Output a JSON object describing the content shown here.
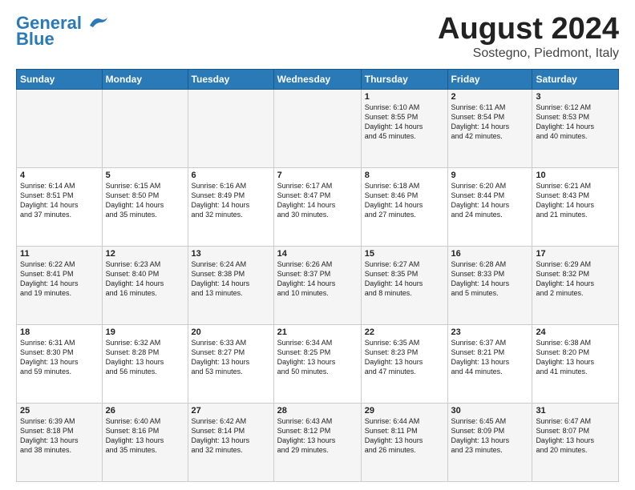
{
  "header": {
    "logo_line1": "General",
    "logo_line2": "Blue",
    "month": "August 2024",
    "location": "Sostegno, Piedmont, Italy"
  },
  "weekdays": [
    "Sunday",
    "Monday",
    "Tuesday",
    "Wednesday",
    "Thursday",
    "Friday",
    "Saturday"
  ],
  "weeks": [
    [
      {
        "num": "",
        "info": ""
      },
      {
        "num": "",
        "info": ""
      },
      {
        "num": "",
        "info": ""
      },
      {
        "num": "",
        "info": ""
      },
      {
        "num": "1",
        "info": "Sunrise: 6:10 AM\nSunset: 8:55 PM\nDaylight: 14 hours\nand 45 minutes."
      },
      {
        "num": "2",
        "info": "Sunrise: 6:11 AM\nSunset: 8:54 PM\nDaylight: 14 hours\nand 42 minutes."
      },
      {
        "num": "3",
        "info": "Sunrise: 6:12 AM\nSunset: 8:53 PM\nDaylight: 14 hours\nand 40 minutes."
      }
    ],
    [
      {
        "num": "4",
        "info": "Sunrise: 6:14 AM\nSunset: 8:51 PM\nDaylight: 14 hours\nand 37 minutes."
      },
      {
        "num": "5",
        "info": "Sunrise: 6:15 AM\nSunset: 8:50 PM\nDaylight: 14 hours\nand 35 minutes."
      },
      {
        "num": "6",
        "info": "Sunrise: 6:16 AM\nSunset: 8:49 PM\nDaylight: 14 hours\nand 32 minutes."
      },
      {
        "num": "7",
        "info": "Sunrise: 6:17 AM\nSunset: 8:47 PM\nDaylight: 14 hours\nand 30 minutes."
      },
      {
        "num": "8",
        "info": "Sunrise: 6:18 AM\nSunset: 8:46 PM\nDaylight: 14 hours\nand 27 minutes."
      },
      {
        "num": "9",
        "info": "Sunrise: 6:20 AM\nSunset: 8:44 PM\nDaylight: 14 hours\nand 24 minutes."
      },
      {
        "num": "10",
        "info": "Sunrise: 6:21 AM\nSunset: 8:43 PM\nDaylight: 14 hours\nand 21 minutes."
      }
    ],
    [
      {
        "num": "11",
        "info": "Sunrise: 6:22 AM\nSunset: 8:41 PM\nDaylight: 14 hours\nand 19 minutes."
      },
      {
        "num": "12",
        "info": "Sunrise: 6:23 AM\nSunset: 8:40 PM\nDaylight: 14 hours\nand 16 minutes."
      },
      {
        "num": "13",
        "info": "Sunrise: 6:24 AM\nSunset: 8:38 PM\nDaylight: 14 hours\nand 13 minutes."
      },
      {
        "num": "14",
        "info": "Sunrise: 6:26 AM\nSunset: 8:37 PM\nDaylight: 14 hours\nand 10 minutes."
      },
      {
        "num": "15",
        "info": "Sunrise: 6:27 AM\nSunset: 8:35 PM\nDaylight: 14 hours\nand 8 minutes."
      },
      {
        "num": "16",
        "info": "Sunrise: 6:28 AM\nSunset: 8:33 PM\nDaylight: 14 hours\nand 5 minutes."
      },
      {
        "num": "17",
        "info": "Sunrise: 6:29 AM\nSunset: 8:32 PM\nDaylight: 14 hours\nand 2 minutes."
      }
    ],
    [
      {
        "num": "18",
        "info": "Sunrise: 6:31 AM\nSunset: 8:30 PM\nDaylight: 13 hours\nand 59 minutes."
      },
      {
        "num": "19",
        "info": "Sunrise: 6:32 AM\nSunset: 8:28 PM\nDaylight: 13 hours\nand 56 minutes."
      },
      {
        "num": "20",
        "info": "Sunrise: 6:33 AM\nSunset: 8:27 PM\nDaylight: 13 hours\nand 53 minutes."
      },
      {
        "num": "21",
        "info": "Sunrise: 6:34 AM\nSunset: 8:25 PM\nDaylight: 13 hours\nand 50 minutes."
      },
      {
        "num": "22",
        "info": "Sunrise: 6:35 AM\nSunset: 8:23 PM\nDaylight: 13 hours\nand 47 minutes."
      },
      {
        "num": "23",
        "info": "Sunrise: 6:37 AM\nSunset: 8:21 PM\nDaylight: 13 hours\nand 44 minutes."
      },
      {
        "num": "24",
        "info": "Sunrise: 6:38 AM\nSunset: 8:20 PM\nDaylight: 13 hours\nand 41 minutes."
      }
    ],
    [
      {
        "num": "25",
        "info": "Sunrise: 6:39 AM\nSunset: 8:18 PM\nDaylight: 13 hours\nand 38 minutes."
      },
      {
        "num": "26",
        "info": "Sunrise: 6:40 AM\nSunset: 8:16 PM\nDaylight: 13 hours\nand 35 minutes."
      },
      {
        "num": "27",
        "info": "Sunrise: 6:42 AM\nSunset: 8:14 PM\nDaylight: 13 hours\nand 32 minutes."
      },
      {
        "num": "28",
        "info": "Sunrise: 6:43 AM\nSunset: 8:12 PM\nDaylight: 13 hours\nand 29 minutes."
      },
      {
        "num": "29",
        "info": "Sunrise: 6:44 AM\nSunset: 8:11 PM\nDaylight: 13 hours\nand 26 minutes."
      },
      {
        "num": "30",
        "info": "Sunrise: 6:45 AM\nSunset: 8:09 PM\nDaylight: 13 hours\nand 23 minutes."
      },
      {
        "num": "31",
        "info": "Sunrise: 6:47 AM\nSunset: 8:07 PM\nDaylight: 13 hours\nand 20 minutes."
      }
    ]
  ]
}
